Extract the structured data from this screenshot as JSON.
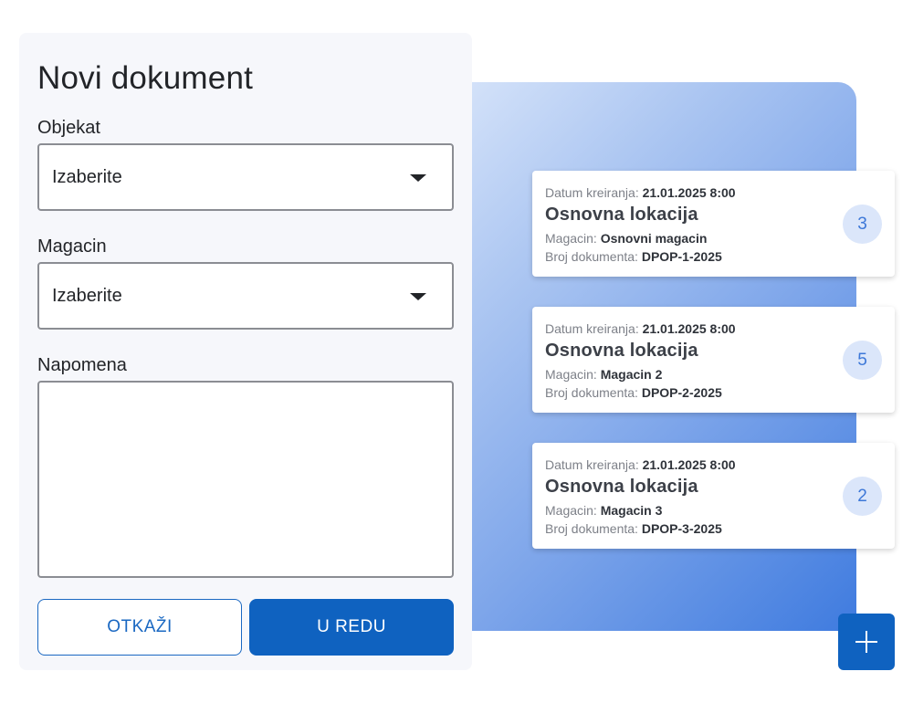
{
  "dialog": {
    "title": "Novi dokument",
    "object_label": "Objekat",
    "object_value": "Izaberite",
    "warehouse_label": "Magacin",
    "warehouse_value": "Izaberite",
    "note_label": "Napomena",
    "note_value": "",
    "cancel_label": "OTKAŽI",
    "ok_label": "U REDU"
  },
  "cards": [
    {
      "created_label": "Datum kreiranja:",
      "created_value": "21.01.2025 8:00",
      "title": "Osnovna lokacija",
      "warehouse_label": "Magacin:",
      "warehouse_value": "Osnovni magacin",
      "doc_label": "Broj dokumenta:",
      "doc_value": "DPOP-1-2025",
      "count": "3"
    },
    {
      "created_label": "Datum kreiranja:",
      "created_value": "21.01.2025 8:00",
      "title": "Osnovna lokacija",
      "warehouse_label": "Magacin:",
      "warehouse_value": "Magacin 2",
      "doc_label": "Broj dokumenta:",
      "doc_value": "DPOP-2-2025",
      "count": "5"
    },
    {
      "created_label": "Datum kreiranja:",
      "created_value": "21.01.2025 8:00",
      "title": "Osnovna lokacija",
      "warehouse_label": "Magacin:",
      "warehouse_value": "Magacin 3",
      "doc_label": "Broj dokumenta:",
      "doc_value": "DPOP-3-2025",
      "count": "2"
    }
  ],
  "fab": {
    "icon": "plus-icon"
  },
  "colors": {
    "primary": "#0f62c0",
    "badge_bg": "#dbe6fa",
    "badge_text": "#3d78d8",
    "dialog_bg": "#f6f7fb"
  }
}
